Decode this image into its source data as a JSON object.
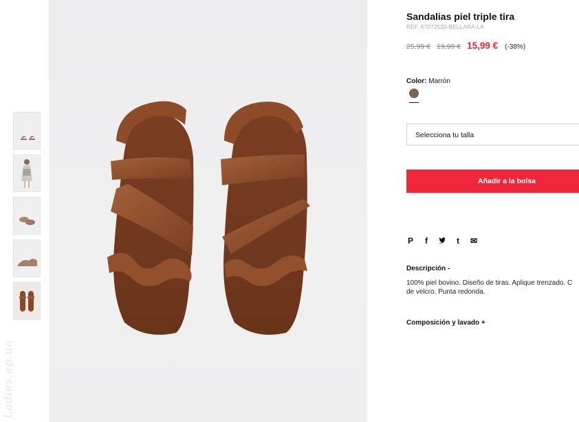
{
  "product": {
    "title": "Sandalias piel triple tira",
    "ref": "REF. 67072520-BELLARA-LA",
    "old_price_1": "25,99 €",
    "old_price_2": "19,99 €",
    "current_price": "15,99 €",
    "discount": "(-38%)"
  },
  "color": {
    "label": "Color:",
    "value": "Marrón",
    "swatch_hex": "#7b6553"
  },
  "size_select": {
    "placeholder": "Selecciona tu talla"
  },
  "add_to_bag": {
    "label": "Añadir a la bolsa",
    "color": "#f2263a"
  },
  "social": {
    "pinterest": "P",
    "facebook": "f",
    "twitter": "t",
    "tumblr": "t",
    "email": "✉"
  },
  "description": {
    "heading": "Descripción -",
    "line1": "100% piel bovino. Diseño de tiras. Aplique trenzado. C",
    "line2": "de velcro. Punta redonda."
  },
  "composition": {
    "heading": "Composición y lavado +"
  },
  "watermark": "Ladies.ep.ua",
  "thumbnails": [
    "thumb-1",
    "thumb-2",
    "thumb-3",
    "thumb-4",
    "thumb-5"
  ]
}
